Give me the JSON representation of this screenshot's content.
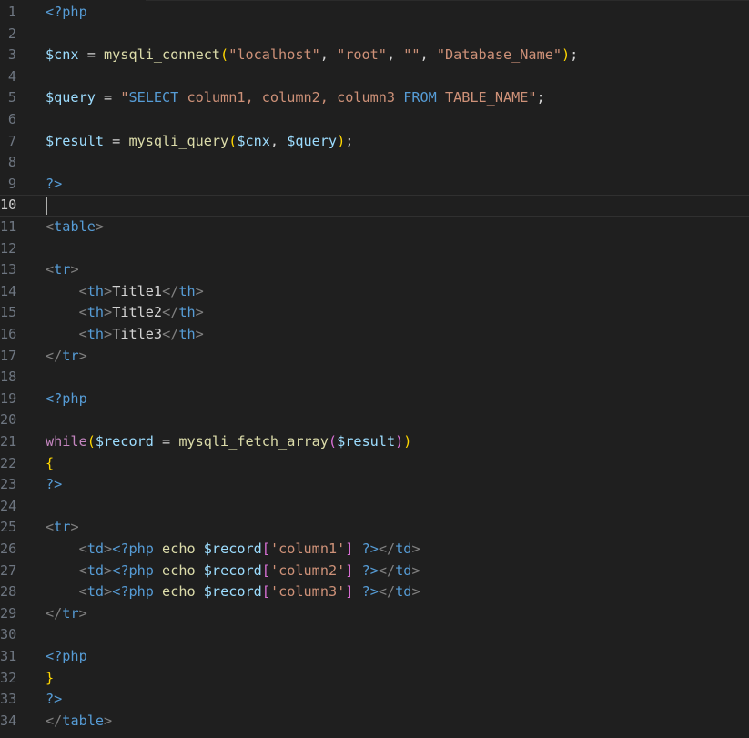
{
  "editor": {
    "lines": [
      {
        "n": "1",
        "tokens": [
          {
            "c": "tag",
            "t": "<?php"
          }
        ]
      },
      {
        "n": "2",
        "tokens": []
      },
      {
        "n": "3",
        "tokens": [
          {
            "c": "var",
            "t": "$cnx"
          },
          {
            "c": "txt",
            "t": " = "
          },
          {
            "c": "fn",
            "t": "mysqli_connect"
          },
          {
            "c": "p1",
            "t": "("
          },
          {
            "c": "str",
            "t": "\"localhost\""
          },
          {
            "c": "txt",
            "t": ", "
          },
          {
            "c": "str",
            "t": "\"root\""
          },
          {
            "c": "txt",
            "t": ", "
          },
          {
            "c": "str",
            "t": "\"\""
          },
          {
            "c": "txt",
            "t": ", "
          },
          {
            "c": "str",
            "t": "\"Database_Name\""
          },
          {
            "c": "p1",
            "t": ")"
          },
          {
            "c": "txt",
            "t": ";"
          }
        ]
      },
      {
        "n": "4",
        "tokens": []
      },
      {
        "n": "5",
        "tokens": [
          {
            "c": "var",
            "t": "$query"
          },
          {
            "c": "txt",
            "t": " = "
          },
          {
            "c": "str",
            "t": "\""
          },
          {
            "c": "sqlkw",
            "t": "SELECT"
          },
          {
            "c": "str",
            "t": " column1, column2, column3 "
          },
          {
            "c": "sqlkw",
            "t": "FROM"
          },
          {
            "c": "str",
            "t": " TABLE_NAME\""
          },
          {
            "c": "txt",
            "t": ";"
          }
        ]
      },
      {
        "n": "6",
        "tokens": []
      },
      {
        "n": "7",
        "tokens": [
          {
            "c": "var",
            "t": "$result"
          },
          {
            "c": "txt",
            "t": " = "
          },
          {
            "c": "fn",
            "t": "mysqli_query"
          },
          {
            "c": "p1",
            "t": "("
          },
          {
            "c": "var",
            "t": "$cnx"
          },
          {
            "c": "txt",
            "t": ", "
          },
          {
            "c": "var",
            "t": "$query"
          },
          {
            "c": "p1",
            "t": ")"
          },
          {
            "c": "txt",
            "t": ";"
          }
        ]
      },
      {
        "n": "8",
        "tokens": []
      },
      {
        "n": "9",
        "tokens": [
          {
            "c": "tag",
            "t": "?>"
          }
        ]
      },
      {
        "n": "10",
        "current": true,
        "tokens": []
      },
      {
        "n": "11",
        "tokens": [
          {
            "c": "br",
            "t": "<"
          },
          {
            "c": "tag",
            "t": "table"
          },
          {
            "c": "br",
            "t": ">"
          }
        ]
      },
      {
        "n": "12",
        "tokens": []
      },
      {
        "n": "13",
        "tokens": [
          {
            "c": "br",
            "t": "<"
          },
          {
            "c": "tag",
            "t": "tr"
          },
          {
            "c": "br",
            "t": ">"
          }
        ]
      },
      {
        "n": "14",
        "tokens": [
          {
            "c": "txt",
            "t": "    "
          },
          {
            "c": "br",
            "t": "<"
          },
          {
            "c": "tag",
            "t": "th"
          },
          {
            "c": "br",
            "t": ">"
          },
          {
            "c": "txt",
            "t": "Title1"
          },
          {
            "c": "br",
            "t": "</"
          },
          {
            "c": "tag",
            "t": "th"
          },
          {
            "c": "br",
            "t": ">"
          }
        ]
      },
      {
        "n": "15",
        "tokens": [
          {
            "c": "txt",
            "t": "    "
          },
          {
            "c": "br",
            "t": "<"
          },
          {
            "c": "tag",
            "t": "th"
          },
          {
            "c": "br",
            "t": ">"
          },
          {
            "c": "txt",
            "t": "Title2"
          },
          {
            "c": "br",
            "t": "</"
          },
          {
            "c": "tag",
            "t": "th"
          },
          {
            "c": "br",
            "t": ">"
          }
        ]
      },
      {
        "n": "16",
        "tokens": [
          {
            "c": "txt",
            "t": "    "
          },
          {
            "c": "br",
            "t": "<"
          },
          {
            "c": "tag",
            "t": "th"
          },
          {
            "c": "br",
            "t": ">"
          },
          {
            "c": "txt",
            "t": "Title3"
          },
          {
            "c": "br",
            "t": "</"
          },
          {
            "c": "tag",
            "t": "th"
          },
          {
            "c": "br",
            "t": ">"
          }
        ]
      },
      {
        "n": "17",
        "tokens": [
          {
            "c": "br",
            "t": "</"
          },
          {
            "c": "tag",
            "t": "tr"
          },
          {
            "c": "br",
            "t": ">"
          }
        ]
      },
      {
        "n": "18",
        "tokens": []
      },
      {
        "n": "19",
        "tokens": [
          {
            "c": "tag",
            "t": "<?php"
          }
        ]
      },
      {
        "n": "20",
        "tokens": []
      },
      {
        "n": "21",
        "tokens": [
          {
            "c": "kw",
            "t": "while"
          },
          {
            "c": "p1",
            "t": "("
          },
          {
            "c": "var",
            "t": "$record"
          },
          {
            "c": "txt",
            "t": " = "
          },
          {
            "c": "fn",
            "t": "mysqli_fetch_array"
          },
          {
            "c": "p2",
            "t": "("
          },
          {
            "c": "var",
            "t": "$result"
          },
          {
            "c": "p2",
            "t": ")"
          },
          {
            "c": "p1",
            "t": ")"
          }
        ]
      },
      {
        "n": "22",
        "tokens": [
          {
            "c": "p1",
            "t": "{"
          }
        ]
      },
      {
        "n": "23",
        "tokens": [
          {
            "c": "tag",
            "t": "?>"
          }
        ]
      },
      {
        "n": "24",
        "tokens": []
      },
      {
        "n": "25",
        "tokens": [
          {
            "c": "br",
            "t": "<"
          },
          {
            "c": "tag",
            "t": "tr"
          },
          {
            "c": "br",
            "t": ">"
          }
        ]
      },
      {
        "n": "26",
        "tokens": [
          {
            "c": "txt",
            "t": "    "
          },
          {
            "c": "br",
            "t": "<"
          },
          {
            "c": "tag",
            "t": "td"
          },
          {
            "c": "br",
            "t": ">"
          },
          {
            "c": "tag",
            "t": "<?php"
          },
          {
            "c": "fn",
            "t": " echo "
          },
          {
            "c": "var",
            "t": "$record"
          },
          {
            "c": "p2",
            "t": "["
          },
          {
            "c": "str",
            "t": "'column1'"
          },
          {
            "c": "p2",
            "t": "]"
          },
          {
            "c": "tag",
            "t": " ?>"
          },
          {
            "c": "br",
            "t": "</"
          },
          {
            "c": "tag",
            "t": "td"
          },
          {
            "c": "br",
            "t": ">"
          }
        ]
      },
      {
        "n": "27",
        "tokens": [
          {
            "c": "txt",
            "t": "    "
          },
          {
            "c": "br",
            "t": "<"
          },
          {
            "c": "tag",
            "t": "td"
          },
          {
            "c": "br",
            "t": ">"
          },
          {
            "c": "tag",
            "t": "<?php"
          },
          {
            "c": "fn",
            "t": " echo "
          },
          {
            "c": "var",
            "t": "$record"
          },
          {
            "c": "p2",
            "t": "["
          },
          {
            "c": "str",
            "t": "'column2'"
          },
          {
            "c": "p2",
            "t": "]"
          },
          {
            "c": "tag",
            "t": " ?>"
          },
          {
            "c": "br",
            "t": "</"
          },
          {
            "c": "tag",
            "t": "td"
          },
          {
            "c": "br",
            "t": ">"
          }
        ]
      },
      {
        "n": "28",
        "tokens": [
          {
            "c": "txt",
            "t": "    "
          },
          {
            "c": "br",
            "t": "<"
          },
          {
            "c": "tag",
            "t": "td"
          },
          {
            "c": "br",
            "t": ">"
          },
          {
            "c": "tag",
            "t": "<?php"
          },
          {
            "c": "fn",
            "t": " echo "
          },
          {
            "c": "var",
            "t": "$record"
          },
          {
            "c": "p2",
            "t": "["
          },
          {
            "c": "str",
            "t": "'column3'"
          },
          {
            "c": "p2",
            "t": "]"
          },
          {
            "c": "tag",
            "t": " ?>"
          },
          {
            "c": "br",
            "t": "</"
          },
          {
            "c": "tag",
            "t": "td"
          },
          {
            "c": "br",
            "t": ">"
          }
        ]
      },
      {
        "n": "29",
        "tokens": [
          {
            "c": "br",
            "t": "</"
          },
          {
            "c": "tag",
            "t": "tr"
          },
          {
            "c": "br",
            "t": ">"
          }
        ]
      },
      {
        "n": "30",
        "tokens": []
      },
      {
        "n": "31",
        "tokens": [
          {
            "c": "tag",
            "t": "<?php"
          }
        ]
      },
      {
        "n": "32",
        "tokens": [
          {
            "c": "p1",
            "t": "}"
          }
        ]
      },
      {
        "n": "33",
        "tokens": [
          {
            "c": "tag",
            "t": "?>"
          }
        ]
      },
      {
        "n": "34",
        "tokens": [
          {
            "c": "br",
            "t": "</"
          },
          {
            "c": "tag",
            "t": "table"
          },
          {
            "c": "br",
            "t": ">"
          }
        ]
      }
    ]
  }
}
